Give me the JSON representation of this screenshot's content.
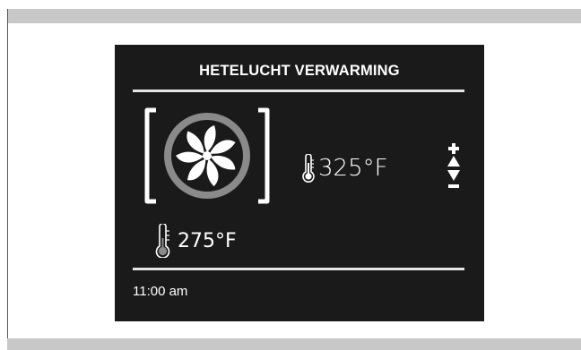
{
  "display": {
    "title": "HETELUCHT VERWARMING",
    "set_temperature": "325°F",
    "current_temperature": "275°F",
    "time": "11:00 am"
  },
  "icons": {
    "mode": "fan-icon",
    "set_temp": "thermometer-icon",
    "current_temp": "thermometer-icon",
    "increase": "plus-up-arrow-icon",
    "decrease": "minus-down-arrow-icon"
  },
  "colors": {
    "screen_bg": "#1a1a1a",
    "text": "#ffffff",
    "fan_ring": "#8a8a8a",
    "frame_bars": "#c8c8c8"
  }
}
